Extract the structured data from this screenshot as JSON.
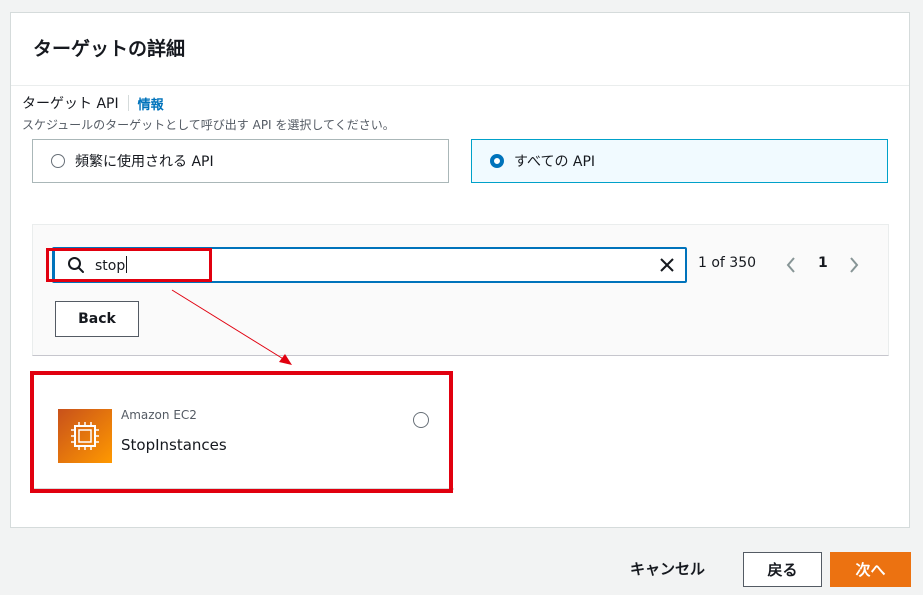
{
  "panel": {
    "title": "ターゲットの詳細"
  },
  "target_api": {
    "label": "ターゲット API",
    "info_link": "情報",
    "description": "スケジュールのターゲットとして呼び出す API を選択してください。",
    "options": [
      {
        "label": "頻繁に使用される API",
        "selected": false
      },
      {
        "label": "すべての API",
        "selected": true
      }
    ]
  },
  "search": {
    "value": "stop",
    "icon": "search-icon",
    "clear_icon": "close-icon"
  },
  "pagination": {
    "count": "1 of 350",
    "current_page": "1"
  },
  "back_button": "Back",
  "result_card": {
    "service": "Amazon EC2",
    "api": "StopInstances",
    "icon": "ec2-icon",
    "selected": false
  },
  "footer": {
    "cancel": "キャンセル",
    "previous": "戻る",
    "next": "次へ"
  },
  "colors": {
    "accent": "#0073bb",
    "primary_button": "#ec7211",
    "highlight": "#e1000f"
  }
}
